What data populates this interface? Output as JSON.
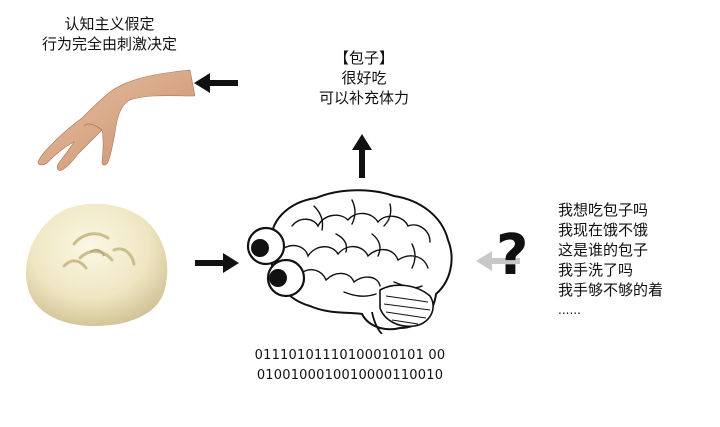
{
  "top_left": {
    "lines": [
      "认知主义假定",
      "行为完全由刺激决定"
    ]
  },
  "top_center": {
    "lines": [
      "【包子】",
      "很好吃",
      "可以补充体力"
    ]
  },
  "right": {
    "lines": [
      "我想吃包子吗",
      "我现在饿不饿",
      "这是谁的包子",
      "我手洗了吗",
      "我手够不够的着",
      "......"
    ]
  },
  "binary": {
    "lines": [
      "01110101110100010101 00",
      "0100100010010000110010"
    ]
  },
  "question_mark": "?",
  "icons": {
    "hand": "hand-icon",
    "bun": "steamed-bun-icon",
    "brain": "brain-with-eyes-icon",
    "arrows": [
      "arrow-left-icon",
      "arrow-right-icon",
      "arrow-up-icon",
      "arrow-left-gray-icon"
    ]
  },
  "colors": {
    "ink": "#111111",
    "bun_light": "#f3eccf",
    "bun_shadow": "#cfc39a",
    "skin": "#d9a98a",
    "gray_arrow": "#c8c8c8"
  }
}
